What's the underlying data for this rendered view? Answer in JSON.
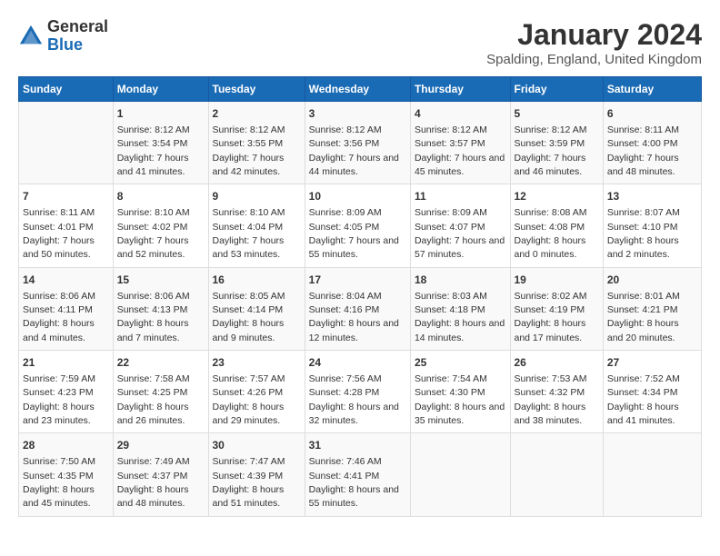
{
  "header": {
    "logo": {
      "general": "General",
      "blue": "Blue"
    },
    "title": "January 2024",
    "location": "Spalding, England, United Kingdom"
  },
  "days_of_week": [
    "Sunday",
    "Monday",
    "Tuesday",
    "Wednesday",
    "Thursday",
    "Friday",
    "Saturday"
  ],
  "weeks": [
    [
      {
        "day": "",
        "sunrise": "",
        "sunset": "",
        "daylight": ""
      },
      {
        "day": "1",
        "sunrise": "Sunrise: 8:12 AM",
        "sunset": "Sunset: 3:54 PM",
        "daylight": "Daylight: 7 hours and 41 minutes."
      },
      {
        "day": "2",
        "sunrise": "Sunrise: 8:12 AM",
        "sunset": "Sunset: 3:55 PM",
        "daylight": "Daylight: 7 hours and 42 minutes."
      },
      {
        "day": "3",
        "sunrise": "Sunrise: 8:12 AM",
        "sunset": "Sunset: 3:56 PM",
        "daylight": "Daylight: 7 hours and 44 minutes."
      },
      {
        "day": "4",
        "sunrise": "Sunrise: 8:12 AM",
        "sunset": "Sunset: 3:57 PM",
        "daylight": "Daylight: 7 hours and 45 minutes."
      },
      {
        "day": "5",
        "sunrise": "Sunrise: 8:12 AM",
        "sunset": "Sunset: 3:59 PM",
        "daylight": "Daylight: 7 hours and 46 minutes."
      },
      {
        "day": "6",
        "sunrise": "Sunrise: 8:11 AM",
        "sunset": "Sunset: 4:00 PM",
        "daylight": "Daylight: 7 hours and 48 minutes."
      }
    ],
    [
      {
        "day": "7",
        "sunrise": "Sunrise: 8:11 AM",
        "sunset": "Sunset: 4:01 PM",
        "daylight": "Daylight: 7 hours and 50 minutes."
      },
      {
        "day": "8",
        "sunrise": "Sunrise: 8:10 AM",
        "sunset": "Sunset: 4:02 PM",
        "daylight": "Daylight: 7 hours and 52 minutes."
      },
      {
        "day": "9",
        "sunrise": "Sunrise: 8:10 AM",
        "sunset": "Sunset: 4:04 PM",
        "daylight": "Daylight: 7 hours and 53 minutes."
      },
      {
        "day": "10",
        "sunrise": "Sunrise: 8:09 AM",
        "sunset": "Sunset: 4:05 PM",
        "daylight": "Daylight: 7 hours and 55 minutes."
      },
      {
        "day": "11",
        "sunrise": "Sunrise: 8:09 AM",
        "sunset": "Sunset: 4:07 PM",
        "daylight": "Daylight: 7 hours and 57 minutes."
      },
      {
        "day": "12",
        "sunrise": "Sunrise: 8:08 AM",
        "sunset": "Sunset: 4:08 PM",
        "daylight": "Daylight: 8 hours and 0 minutes."
      },
      {
        "day": "13",
        "sunrise": "Sunrise: 8:07 AM",
        "sunset": "Sunset: 4:10 PM",
        "daylight": "Daylight: 8 hours and 2 minutes."
      }
    ],
    [
      {
        "day": "14",
        "sunrise": "Sunrise: 8:06 AM",
        "sunset": "Sunset: 4:11 PM",
        "daylight": "Daylight: 8 hours and 4 minutes."
      },
      {
        "day": "15",
        "sunrise": "Sunrise: 8:06 AM",
        "sunset": "Sunset: 4:13 PM",
        "daylight": "Daylight: 8 hours and 7 minutes."
      },
      {
        "day": "16",
        "sunrise": "Sunrise: 8:05 AM",
        "sunset": "Sunset: 4:14 PM",
        "daylight": "Daylight: 8 hours and 9 minutes."
      },
      {
        "day": "17",
        "sunrise": "Sunrise: 8:04 AM",
        "sunset": "Sunset: 4:16 PM",
        "daylight": "Daylight: 8 hours and 12 minutes."
      },
      {
        "day": "18",
        "sunrise": "Sunrise: 8:03 AM",
        "sunset": "Sunset: 4:18 PM",
        "daylight": "Daylight: 8 hours and 14 minutes."
      },
      {
        "day": "19",
        "sunrise": "Sunrise: 8:02 AM",
        "sunset": "Sunset: 4:19 PM",
        "daylight": "Daylight: 8 hours and 17 minutes."
      },
      {
        "day": "20",
        "sunrise": "Sunrise: 8:01 AM",
        "sunset": "Sunset: 4:21 PM",
        "daylight": "Daylight: 8 hours and 20 minutes."
      }
    ],
    [
      {
        "day": "21",
        "sunrise": "Sunrise: 7:59 AM",
        "sunset": "Sunset: 4:23 PM",
        "daylight": "Daylight: 8 hours and 23 minutes."
      },
      {
        "day": "22",
        "sunrise": "Sunrise: 7:58 AM",
        "sunset": "Sunset: 4:25 PM",
        "daylight": "Daylight: 8 hours and 26 minutes."
      },
      {
        "day": "23",
        "sunrise": "Sunrise: 7:57 AM",
        "sunset": "Sunset: 4:26 PM",
        "daylight": "Daylight: 8 hours and 29 minutes."
      },
      {
        "day": "24",
        "sunrise": "Sunrise: 7:56 AM",
        "sunset": "Sunset: 4:28 PM",
        "daylight": "Daylight: 8 hours and 32 minutes."
      },
      {
        "day": "25",
        "sunrise": "Sunrise: 7:54 AM",
        "sunset": "Sunset: 4:30 PM",
        "daylight": "Daylight: 8 hours and 35 minutes."
      },
      {
        "day": "26",
        "sunrise": "Sunrise: 7:53 AM",
        "sunset": "Sunset: 4:32 PM",
        "daylight": "Daylight: 8 hours and 38 minutes."
      },
      {
        "day": "27",
        "sunrise": "Sunrise: 7:52 AM",
        "sunset": "Sunset: 4:34 PM",
        "daylight": "Daylight: 8 hours and 41 minutes."
      }
    ],
    [
      {
        "day": "28",
        "sunrise": "Sunrise: 7:50 AM",
        "sunset": "Sunset: 4:35 PM",
        "daylight": "Daylight: 8 hours and 45 minutes."
      },
      {
        "day": "29",
        "sunrise": "Sunrise: 7:49 AM",
        "sunset": "Sunset: 4:37 PM",
        "daylight": "Daylight: 8 hours and 48 minutes."
      },
      {
        "day": "30",
        "sunrise": "Sunrise: 7:47 AM",
        "sunset": "Sunset: 4:39 PM",
        "daylight": "Daylight: 8 hours and 51 minutes."
      },
      {
        "day": "31",
        "sunrise": "Sunrise: 7:46 AM",
        "sunset": "Sunset: 4:41 PM",
        "daylight": "Daylight: 8 hours and 55 minutes."
      },
      {
        "day": "",
        "sunrise": "",
        "sunset": "",
        "daylight": ""
      },
      {
        "day": "",
        "sunrise": "",
        "sunset": "",
        "daylight": ""
      },
      {
        "day": "",
        "sunrise": "",
        "sunset": "",
        "daylight": ""
      }
    ]
  ]
}
